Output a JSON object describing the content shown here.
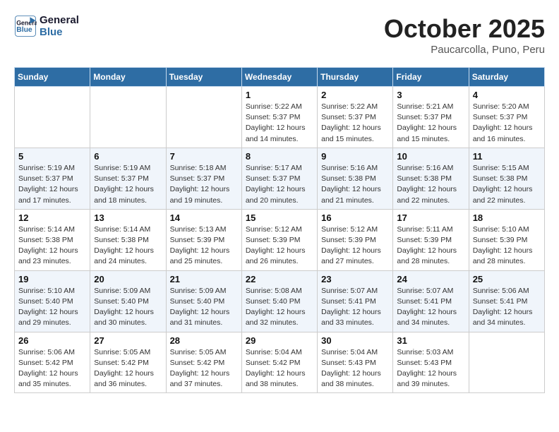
{
  "header": {
    "logo_line1": "General",
    "logo_line2": "Blue",
    "month": "October 2025",
    "location": "Paucarcolla, Puno, Peru"
  },
  "days_of_week": [
    "Sunday",
    "Monday",
    "Tuesday",
    "Wednesday",
    "Thursday",
    "Friday",
    "Saturday"
  ],
  "weeks": [
    [
      {
        "day": "",
        "info": ""
      },
      {
        "day": "",
        "info": ""
      },
      {
        "day": "",
        "info": ""
      },
      {
        "day": "1",
        "info": "Sunrise: 5:22 AM\nSunset: 5:37 PM\nDaylight: 12 hours\nand 14 minutes."
      },
      {
        "day": "2",
        "info": "Sunrise: 5:22 AM\nSunset: 5:37 PM\nDaylight: 12 hours\nand 15 minutes."
      },
      {
        "day": "3",
        "info": "Sunrise: 5:21 AM\nSunset: 5:37 PM\nDaylight: 12 hours\nand 15 minutes."
      },
      {
        "day": "4",
        "info": "Sunrise: 5:20 AM\nSunset: 5:37 PM\nDaylight: 12 hours\nand 16 minutes."
      }
    ],
    [
      {
        "day": "5",
        "info": "Sunrise: 5:19 AM\nSunset: 5:37 PM\nDaylight: 12 hours\nand 17 minutes."
      },
      {
        "day": "6",
        "info": "Sunrise: 5:19 AM\nSunset: 5:37 PM\nDaylight: 12 hours\nand 18 minutes."
      },
      {
        "day": "7",
        "info": "Sunrise: 5:18 AM\nSunset: 5:37 PM\nDaylight: 12 hours\nand 19 minutes."
      },
      {
        "day": "8",
        "info": "Sunrise: 5:17 AM\nSunset: 5:37 PM\nDaylight: 12 hours\nand 20 minutes."
      },
      {
        "day": "9",
        "info": "Sunrise: 5:16 AM\nSunset: 5:38 PM\nDaylight: 12 hours\nand 21 minutes."
      },
      {
        "day": "10",
        "info": "Sunrise: 5:16 AM\nSunset: 5:38 PM\nDaylight: 12 hours\nand 22 minutes."
      },
      {
        "day": "11",
        "info": "Sunrise: 5:15 AM\nSunset: 5:38 PM\nDaylight: 12 hours\nand 22 minutes."
      }
    ],
    [
      {
        "day": "12",
        "info": "Sunrise: 5:14 AM\nSunset: 5:38 PM\nDaylight: 12 hours\nand 23 minutes."
      },
      {
        "day": "13",
        "info": "Sunrise: 5:14 AM\nSunset: 5:38 PM\nDaylight: 12 hours\nand 24 minutes."
      },
      {
        "day": "14",
        "info": "Sunrise: 5:13 AM\nSunset: 5:39 PM\nDaylight: 12 hours\nand 25 minutes."
      },
      {
        "day": "15",
        "info": "Sunrise: 5:12 AM\nSunset: 5:39 PM\nDaylight: 12 hours\nand 26 minutes."
      },
      {
        "day": "16",
        "info": "Sunrise: 5:12 AM\nSunset: 5:39 PM\nDaylight: 12 hours\nand 27 minutes."
      },
      {
        "day": "17",
        "info": "Sunrise: 5:11 AM\nSunset: 5:39 PM\nDaylight: 12 hours\nand 28 minutes."
      },
      {
        "day": "18",
        "info": "Sunrise: 5:10 AM\nSunset: 5:39 PM\nDaylight: 12 hours\nand 28 minutes."
      }
    ],
    [
      {
        "day": "19",
        "info": "Sunrise: 5:10 AM\nSunset: 5:40 PM\nDaylight: 12 hours\nand 29 minutes."
      },
      {
        "day": "20",
        "info": "Sunrise: 5:09 AM\nSunset: 5:40 PM\nDaylight: 12 hours\nand 30 minutes."
      },
      {
        "day": "21",
        "info": "Sunrise: 5:09 AM\nSunset: 5:40 PM\nDaylight: 12 hours\nand 31 minutes."
      },
      {
        "day": "22",
        "info": "Sunrise: 5:08 AM\nSunset: 5:40 PM\nDaylight: 12 hours\nand 32 minutes."
      },
      {
        "day": "23",
        "info": "Sunrise: 5:07 AM\nSunset: 5:41 PM\nDaylight: 12 hours\nand 33 minutes."
      },
      {
        "day": "24",
        "info": "Sunrise: 5:07 AM\nSunset: 5:41 PM\nDaylight: 12 hours\nand 34 minutes."
      },
      {
        "day": "25",
        "info": "Sunrise: 5:06 AM\nSunset: 5:41 PM\nDaylight: 12 hours\nand 34 minutes."
      }
    ],
    [
      {
        "day": "26",
        "info": "Sunrise: 5:06 AM\nSunset: 5:42 PM\nDaylight: 12 hours\nand 35 minutes."
      },
      {
        "day": "27",
        "info": "Sunrise: 5:05 AM\nSunset: 5:42 PM\nDaylight: 12 hours\nand 36 minutes."
      },
      {
        "day": "28",
        "info": "Sunrise: 5:05 AM\nSunset: 5:42 PM\nDaylight: 12 hours\nand 37 minutes."
      },
      {
        "day": "29",
        "info": "Sunrise: 5:04 AM\nSunset: 5:42 PM\nDaylight: 12 hours\nand 38 minutes."
      },
      {
        "day": "30",
        "info": "Sunrise: 5:04 AM\nSunset: 5:43 PM\nDaylight: 12 hours\nand 38 minutes."
      },
      {
        "day": "31",
        "info": "Sunrise: 5:03 AM\nSunset: 5:43 PM\nDaylight: 12 hours\nand 39 minutes."
      },
      {
        "day": "",
        "info": ""
      }
    ]
  ]
}
